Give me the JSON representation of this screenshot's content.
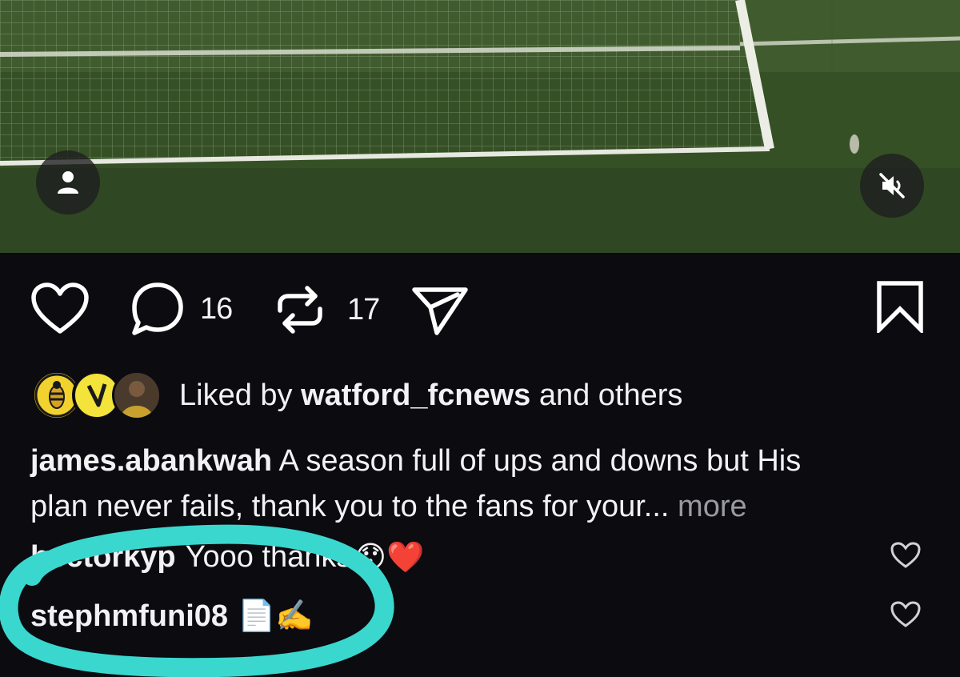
{
  "post": {
    "actions": {
      "comment_count": "16",
      "repost_count": "17"
    },
    "liked_by": {
      "prefix": "Liked by",
      "user": "watford_fcnews",
      "suffix": "and others"
    },
    "caption": {
      "username": "james.abankwah",
      "text_line1": "A season full of ups and downs but His",
      "text_line2": "plan never fails, thank you to the fans for your",
      "ellipsis": "...",
      "more_label": "more"
    },
    "comments": [
      {
        "username": "hectorkyp",
        "text": "Yooo thanks",
        "emoji": "😯❤️"
      },
      {
        "username": "stephmfuni08",
        "text": "",
        "emoji": "📄✍️"
      }
    ]
  },
  "icons": {
    "profile": "person-icon",
    "mute": "speaker-muted-icon",
    "like": "heart-outline-icon",
    "comment": "speech-bubble-icon",
    "repost": "repost-arrows-icon",
    "share": "paper-plane-icon",
    "save": "bookmark-icon"
  },
  "colors": {
    "background": "#0b0b10",
    "text": "#f2f2f4",
    "muted": "#9a9aa3",
    "annotation": "#3ad7cf"
  }
}
